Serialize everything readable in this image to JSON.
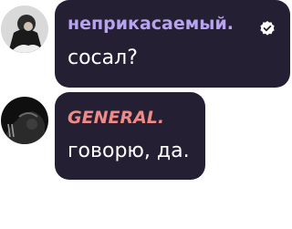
{
  "messages": [
    {
      "author": "неприкасаемый.",
      "text": "сосал?",
      "author_color": "#b7a3f0",
      "verified": true,
      "avatar": "user-photo-avatar"
    },
    {
      "author": "GENERAL.",
      "text": "говорю, да.",
      "author_color": "#f08a86",
      "verified": false,
      "avatar": "user-photo-avatar"
    }
  ],
  "icons": {
    "verified": "verified-badge-icon"
  },
  "colors": {
    "bubble": "#241f33",
    "message_text": "#ffffff"
  }
}
